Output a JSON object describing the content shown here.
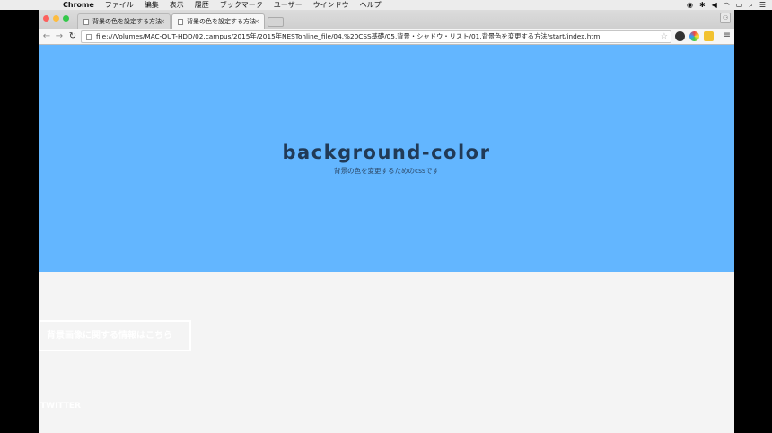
{
  "menubar": {
    "app": "Chrome",
    "items": [
      "ファイル",
      "編集",
      "表示",
      "履歴",
      "ブックマーク",
      "ユーザー",
      "ウインドウ",
      "ヘルプ"
    ]
  },
  "tabs": [
    {
      "title": "背景の色を設定する方法",
      "close": "×"
    },
    {
      "title": "背景の色を設定する方法",
      "close": "×"
    }
  ],
  "toolbar": {
    "back": "←",
    "forward": "→",
    "reload": "↻",
    "url": "file:///Volumes/MAC-OUT-HDD/02.campus/2015年/2015年NESTonline_file/04.%20CSS基礎/05.背景・シャドウ・リスト/01.背景色を変更する方法/start/index.html",
    "star": "☆",
    "menu": "≡"
  },
  "page": {
    "hero_title": "background-color",
    "hero_subtitle": "背景の色を変更するためのcssです",
    "info_button": "背景画像に関する情報はこちら",
    "twitter": "TWITTER"
  },
  "colors": {
    "hero_bg": "#63b6ff",
    "hero_text": "#213a56",
    "page_bg": "#f4f4f4"
  }
}
